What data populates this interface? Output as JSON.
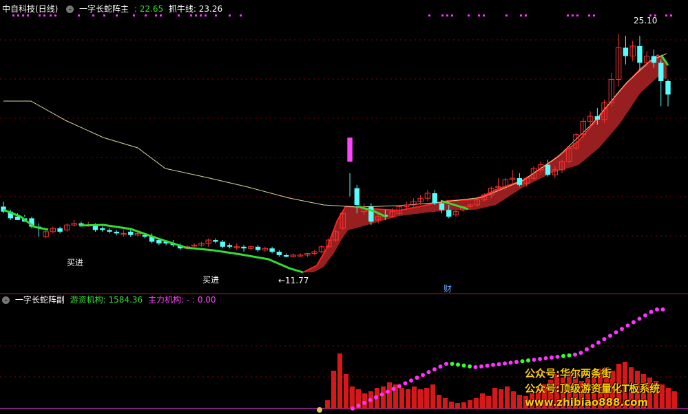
{
  "header": {
    "stock_name": "中自科技(日线)",
    "indicator_name": "一字长蛇阵主",
    "indicator_value": ": 22.65",
    "grab_label": "抓牛线: 23.26"
  },
  "sub_header": {
    "indicator_name": "一字长蛇阵副",
    "youzi_label": "游资机构: 1584.36",
    "zhuli_label": "主力机构: - : 0.00"
  },
  "annotations": {
    "buy1": "买进",
    "buy2": "买进",
    "high": "25.10",
    "low": "←11.77",
    "cai": "财"
  },
  "watermark": {
    "line1": "公众号:华尔两条街",
    "line2": "公众号:顶级游资量化T板系统",
    "line3": "www.zhibiao888.com"
  },
  "colors": {
    "up": "#ff3232",
    "down": "#54ffff",
    "green_line": "#33dd33",
    "ribbon": "#a82222",
    "dots": "#ff33ff",
    "dots_green": "#33ff33",
    "ma_line": "#ddd8a0"
  },
  "chart_data": {
    "type": "candlestick",
    "price_range": [
      10.5,
      26.0
    ],
    "candles": [
      [
        14.8,
        15.1,
        14.5,
        14.4
      ],
      [
        14.5,
        14.6,
        14.1,
        14.0
      ],
      [
        14.2,
        14.4,
        14.0,
        14.2
      ],
      [
        14.1,
        14.3,
        13.9,
        14.2
      ],
      [
        14.1,
        14.2,
        13.6,
        13.5
      ],
      [
        13.6,
        13.8,
        13.5,
        13.0
      ],
      [
        13.0,
        13.4,
        13.3,
        12.9
      ],
      [
        13.3,
        13.6,
        13.5,
        13.2
      ],
      [
        13.5,
        13.6,
        13.3,
        13.2
      ],
      [
        13.4,
        13.8,
        13.7,
        13.3
      ],
      [
        13.7,
        14.0,
        13.8,
        13.6
      ],
      [
        13.8,
        13.9,
        13.7,
        13.6
      ],
      [
        13.7,
        13.9,
        13.7,
        13.6
      ],
      [
        13.7,
        13.8,
        13.4,
        13.3
      ],
      [
        13.5,
        13.6,
        13.4,
        13.3
      ],
      [
        13.4,
        13.5,
        13.3,
        13.2
      ],
      [
        13.3,
        13.4,
        13.2,
        13.1
      ],
      [
        13.2,
        13.4,
        13.2,
        13.0
      ],
      [
        13.3,
        13.4,
        13.1,
        13.0
      ],
      [
        13.1,
        13.3,
        13.2,
        13.0
      ],
      [
        13.1,
        13.2,
        13.0,
        12.9
      ],
      [
        13.0,
        13.2,
        12.7,
        12.6
      ],
      [
        12.8,
        12.9,
        12.6,
        12.5
      ],
      [
        12.7,
        12.8,
        12.6,
        12.5
      ],
      [
        12.6,
        12.8,
        12.5,
        12.4
      ],
      [
        12.5,
        12.6,
        12.3,
        12.2
      ],
      [
        12.3,
        12.5,
        12.4,
        12.2
      ],
      [
        12.5,
        12.6,
        12.5,
        12.4
      ],
      [
        12.5,
        12.7,
        12.6,
        12.4
      ],
      [
        12.6,
        12.9,
        12.8,
        12.4
      ],
      [
        12.8,
        12.9,
        12.7,
        12.6
      ],
      [
        12.7,
        12.8,
        12.4,
        12.3
      ],
      [
        12.5,
        12.6,
        12.4,
        12.3
      ],
      [
        12.4,
        12.6,
        12.4,
        12.2
      ],
      [
        12.4,
        12.5,
        12.3,
        12.1
      ],
      [
        12.3,
        12.5,
        12.4,
        12.2
      ],
      [
        12.4,
        12.5,
        12.2,
        12.1
      ],
      [
        12.2,
        12.4,
        12.3,
        12.1
      ],
      [
        12.3,
        12.4,
        12.1,
        12.0
      ],
      [
        12.1,
        12.2,
        11.9,
        11.8
      ],
      [
        11.9,
        12.0,
        11.8,
        11.77
      ],
      [
        11.8,
        12.0,
        11.9,
        11.77
      ],
      [
        11.9,
        12.0,
        11.9,
        11.8
      ],
      [
        11.9,
        12.0,
        12.0,
        11.8
      ],
      [
        12.0,
        12.2,
        12.1,
        11.9
      ],
      [
        12.1,
        12.5,
        12.4,
        12.0
      ],
      [
        12.4,
        12.9,
        12.8,
        12.3
      ],
      [
        12.8,
        13.4,
        13.3,
        12.7
      ],
      [
        13.5,
        14.5,
        14.4,
        13.4
      ],
      [
        16.3,
        16.8,
        15.8,
        15.4
      ],
      [
        15.9,
        16.1,
        14.9,
        14.4
      ],
      [
        14.5,
        15.0,
        14.7,
        14.3
      ],
      [
        14.8,
        15.0,
        13.9,
        13.7
      ],
      [
        14.0,
        14.5,
        14.2,
        13.8
      ],
      [
        14.3,
        14.6,
        14.2,
        14.0
      ],
      [
        14.2,
        14.7,
        14.5,
        14.1
      ],
      [
        14.4,
        14.9,
        14.8,
        14.3
      ],
      [
        14.8,
        15.1,
        14.9,
        14.6
      ],
      [
        14.9,
        15.3,
        15.1,
        14.8
      ],
      [
        15.1,
        15.5,
        15.3,
        14.9
      ],
      [
        15.3,
        15.8,
        15.6,
        15.1
      ],
      [
        15.6,
        15.8,
        15.0,
        14.9
      ],
      [
        15.0,
        15.2,
        14.6,
        14.4
      ],
      [
        14.6,
        14.9,
        14.2,
        14.1
      ],
      [
        14.3,
        14.6,
        14.5,
        14.2
      ],
      [
        14.6,
        14.8,
        14.8,
        14.5
      ],
      [
        14.8,
        15.0,
        14.9,
        14.6
      ],
      [
        14.9,
        15.3,
        15.2,
        14.8
      ],
      [
        15.2,
        15.6,
        15.5,
        15.1
      ],
      [
        15.5,
        16.0,
        15.9,
        15.3
      ],
      [
        16.0,
        16.5,
        16.0,
        15.7
      ],
      [
        16.0,
        16.5,
        16.4,
        15.8
      ],
      [
        16.4,
        17.0,
        16.5,
        16.1
      ],
      [
        16.5,
        16.8,
        16.1,
        16.0
      ],
      [
        16.2,
        16.6,
        16.5,
        16.0
      ],
      [
        16.5,
        17.2,
        17.1,
        16.4
      ],
      [
        17.0,
        17.5,
        17.3,
        16.8
      ],
      [
        17.3,
        17.6,
        16.7,
        16.6
      ],
      [
        16.7,
        17.2,
        17.0,
        16.5
      ],
      [
        17.0,
        17.6,
        17.5,
        16.8
      ],
      [
        17.5,
        18.4,
        18.3,
        17.4
      ],
      [
        18.3,
        19.2,
        19.1,
        18.2
      ],
      [
        19.1,
        20.1,
        19.9,
        18.9
      ],
      [
        19.9,
        20.5,
        20.2,
        19.6
      ],
      [
        20.2,
        20.7,
        20.0,
        19.7
      ],
      [
        20.0,
        21.2,
        21.0,
        19.8
      ],
      [
        21.0,
        22.8,
        22.4,
        20.8
      ],
      [
        22.4,
        25.1,
        24.3,
        22.0
      ],
      [
        24.3,
        25.0,
        23.8,
        23.3
      ],
      [
        23.8,
        24.7,
        24.4,
        23.5
      ],
      [
        24.4,
        25.0,
        23.4,
        22.9
      ],
      [
        23.4,
        24.1,
        23.8,
        23.2
      ],
      [
        23.8,
        24.2,
        23.4,
        23.1
      ],
      [
        23.4,
        23.6,
        22.3,
        20.8
      ],
      [
        22.3,
        22.4,
        21.5,
        20.8
      ]
    ]
  }
}
